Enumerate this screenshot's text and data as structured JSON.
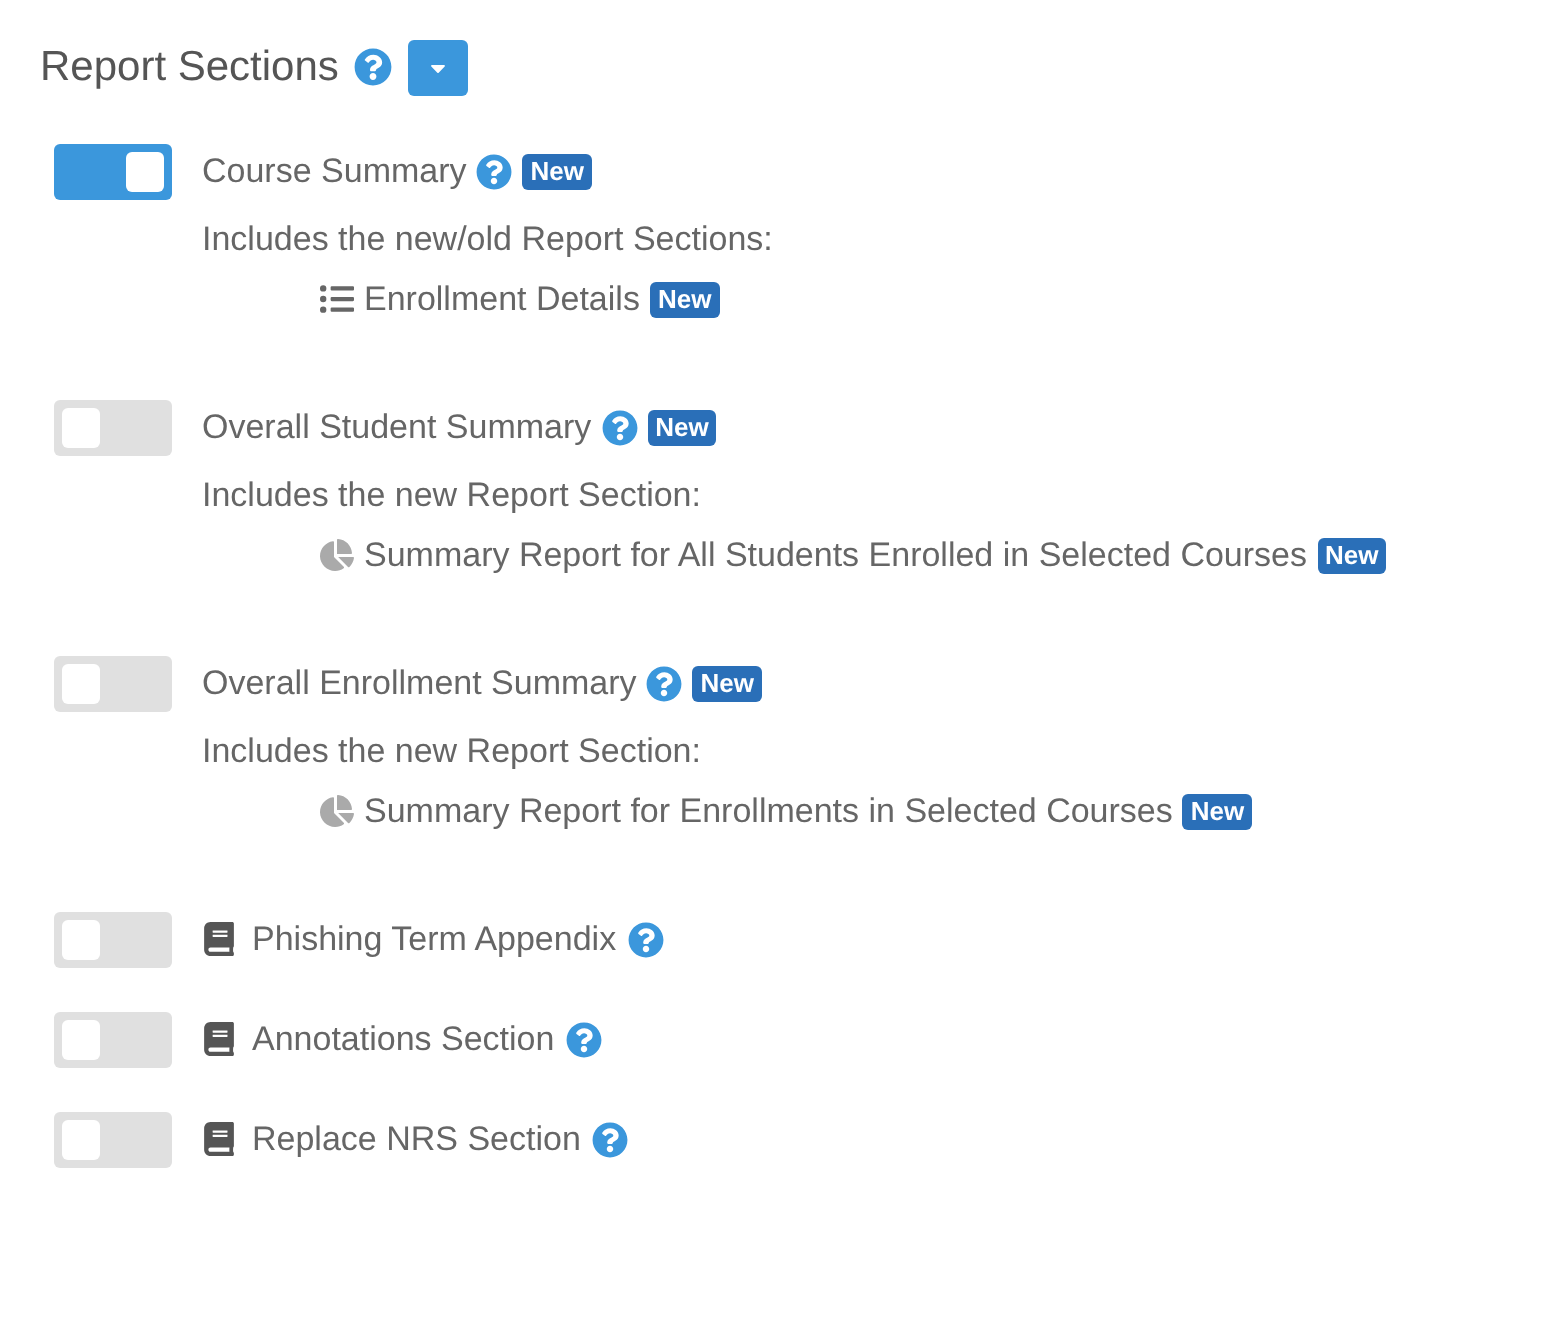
{
  "header": {
    "title": "Report Sections"
  },
  "sections": [
    {
      "kind": "group",
      "label": "Course Summary",
      "on": true,
      "badge": "New",
      "description": "Includes the new/old Report Sections:",
      "items": [
        {
          "kind": "list",
          "label": "Enrollment Details",
          "badge": "New"
        }
      ]
    },
    {
      "kind": "group",
      "label": "Overall Student Summary",
      "on": false,
      "badge": "New",
      "description": "Includes the new Report Section:",
      "items": [
        {
          "kind": "pie",
          "label": "Summary Report for All Students Enrolled in Selected Courses",
          "badge": "New"
        }
      ]
    },
    {
      "kind": "group",
      "label": "Overall Enrollment Summary",
      "on": false,
      "badge": "New",
      "description": "Includes the new Report Section:",
      "items": [
        {
          "kind": "pie",
          "label": "Summary Report for Enrollments in Selected Courses",
          "badge": "New"
        }
      ]
    },
    {
      "kind": "book",
      "label": "Phishing Term Appendix",
      "on": false
    },
    {
      "kind": "book",
      "label": "Annotations Section",
      "on": false
    },
    {
      "kind": "book",
      "label": "Replace NRS Section",
      "on": false
    }
  ]
}
